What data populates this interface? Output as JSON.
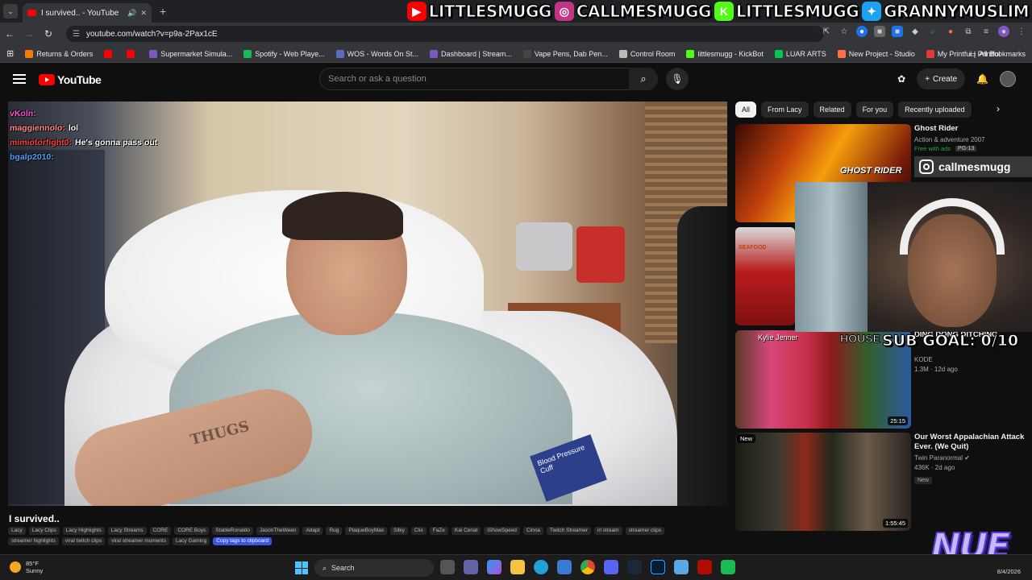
{
  "browser": {
    "tab_title": "I survived.. - YouTube",
    "url": "youtube.com/watch?v=p9a-2Pax1cE",
    "bookmarks": [
      {
        "label": "Returns & Orders",
        "color": "#f57c00"
      },
      {
        "label": "",
        "color": "#ff0000"
      },
      {
        "label": "",
        "color": "#ff0000"
      },
      {
        "label": "Supermarket Simula...",
        "color": "#7e57c2"
      },
      {
        "label": "Spotify - Web Playe...",
        "color": "#1db954"
      },
      {
        "label": "WOS - Words On St...",
        "color": "#5c6bc0"
      },
      {
        "label": "Dashboard | Stream...",
        "color": "#7e57c2"
      },
      {
        "label": "Vape Pens, Dab Pen...",
        "color": "#444444"
      },
      {
        "label": "Control Room",
        "color": "#bbbbbb"
      },
      {
        "label": "littlesmugg - KickBot",
        "color": "#53fc18"
      },
      {
        "label": "LUAR ARTS",
        "color": "#00c853"
      },
      {
        "label": "New Project - Studio",
        "color": "#ff7043"
      },
      {
        "label": "My Printful | Printful",
        "color": "#e53935"
      }
    ],
    "all_bookmarks": "All Bookmarks"
  },
  "overlay_socials": [
    {
      "platform": "youtube",
      "handle": "LITTLESMUGG",
      "color": "#ff0000"
    },
    {
      "platform": "instagram",
      "handle": "CALLMESMUGG",
      "color": "#c13584"
    },
    {
      "platform": "kick",
      "handle": "LITTLESMUGG",
      "color": "#53fc18"
    },
    {
      "platform": "twitter",
      "handle": "GRANNYMUSLIM",
      "color": "#1da1f2"
    }
  ],
  "youtube": {
    "logo": "YouTube",
    "search_placeholder": "Search or ask a question",
    "create_label": "Create",
    "video_title": "I survived..",
    "tags": [
      "Lacy",
      "Lacy Clips",
      "Lacy Highlights",
      "Lacy Streams",
      "CORE",
      "CORE Boys",
      "StableRonaldo",
      "JasonTheWeen",
      "Adapt",
      "Rug",
      "PlaqueBoyMax",
      "Silky",
      "Clix",
      "FaZe",
      "Kai Cenat",
      "iShowSpeed",
      "Cinna",
      "Twitch Streamer",
      "irl stream",
      "streamer clips",
      "streamer highlights",
      "viral twitch clips",
      "viral streamer moments",
      "Lacy Gaming"
    ],
    "copy_tags": "Copy tags to clipboard",
    "chips": [
      "All",
      "From Lacy",
      "Related",
      "For you",
      "Recently uploaded"
    ],
    "recommendations": [
      {
        "title": "Ghost Rider",
        "channel": "Action & adventure 2007",
        "free": "Free with ads",
        "rating": "PG-13",
        "stats": "",
        "duration": "",
        "thumb_text": "GHOST RIDER"
      },
      {
        "title": "",
        "channel": "",
        "stats": "",
        "duration": "",
        "thumb_text": "SEAFOOD"
      },
      {
        "title": "DING DONG DITCHING",
        "channel": "KODE",
        "stats": "1.3M · 12d ago",
        "duration": "25:15",
        "thumb_text": "Kylie Jenner"
      },
      {
        "title": "Our Worst Appalachian Attack Ever. (We Quit)",
        "channel": "Twin Paranormal",
        "stats": "436K · 2d ago",
        "duration": "1:55:45",
        "new": "New"
      }
    ]
  },
  "chat": [
    {
      "user": "vKoln:",
      "message": "",
      "color": "#ff4fcf"
    },
    {
      "user": "maggiennolo:",
      "message": "lol",
      "color": "#ff8a8a"
    },
    {
      "user": "mimiotorfight0:",
      "message": "He's gonna pass out",
      "color": "#ff3c3c"
    },
    {
      "user": "bgalp2010:",
      "message": "",
      "color": "#4fa3ff"
    }
  ],
  "stream_overlay": {
    "ig_handle": "callmesmugg",
    "sub_goal": "SUB GOAL: 0/10",
    "brand": "NUE",
    "thumb_house_text": "HOUSE"
  },
  "player_frame": {
    "bag_label": "Blood Pressure Cuff",
    "tattoo_text": "THUGS"
  },
  "taskbar": {
    "temperature": "85°F",
    "condition": "Sunny",
    "search_label": "Search",
    "date": "8/4/2026"
  }
}
